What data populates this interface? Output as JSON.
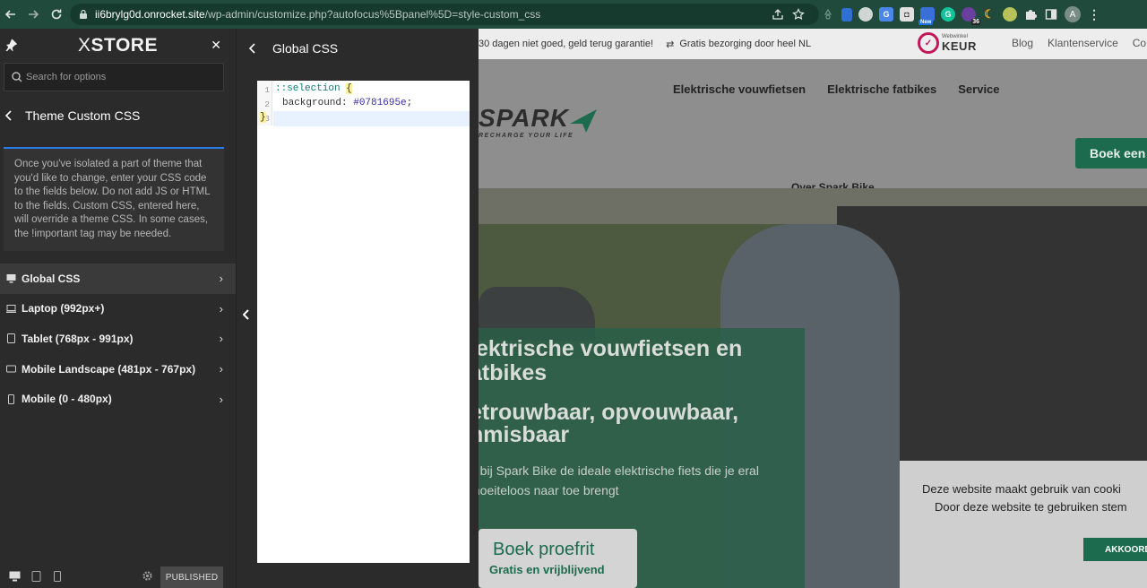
{
  "browser": {
    "url_host": "ii6brylg0d.onrocket.site",
    "url_path": "/wp-admin/customize.php?autofocus%5Bpanel%5D=style-custom_css",
    "extension_badge": "36",
    "new_badge": "New",
    "profile_initial": "A"
  },
  "sidebar": {
    "logo_x": "X",
    "logo_text": "STORE",
    "search_placeholder": "Search for options",
    "section_title": "Theme Custom CSS",
    "notice": "Once you've isolated a part of theme that you'd like to change, enter your CSS code to the fields below. Do not add JS or HTML to the fields. Custom CSS, entered here, will override a theme CSS. In some cases, the !important tag may be needed.",
    "items": [
      {
        "label": "Global CSS",
        "icon": "desktop-icon",
        "active": true
      },
      {
        "label": "Laptop (992px+)",
        "icon": "laptop-icon",
        "active": false
      },
      {
        "label": "Tablet (768px - 991px)",
        "icon": "tablet-icon",
        "active": false
      },
      {
        "label": "Mobile Landscape (481px - 767px)",
        "icon": "mobile-landscape-icon",
        "active": false
      },
      {
        "label": "Mobile (0 - 480px)",
        "icon": "mobile-icon",
        "active": false
      }
    ],
    "publish_label": "PUBLISHED"
  },
  "panel": {
    "title": "Global CSS",
    "code_lines": [
      {
        "num": "1",
        "selector": "::selection",
        "brace": "{"
      },
      {
        "num": "2",
        "property": "background:",
        "value": "#0781695e",
        "semi": ";"
      },
      {
        "num": "3",
        "brace": "}"
      }
    ]
  },
  "site": {
    "promo1": "30 dagen niet goed, geld terug garantie!",
    "promo2": "Gratis bezorging door heel NL",
    "keur_small": "Webwinkel",
    "keur_big": "KEUR",
    "top_links": [
      "Blog",
      "Klantenservice",
      "Co"
    ],
    "nav": [
      "Elektrische vouwfietsen",
      "Elektrische fatbikes",
      "Service"
    ],
    "logo_text": "SPARK",
    "logo_tagline": "RECHARGE YOUR LIFE",
    "boek_een": "Boek een",
    "over": "Over Spark Bike",
    "hero_h1": "lektrische vouwfietsen en atbikes",
    "hero_h2": "etrouwbaar, opvouwbaar, nmisbaar",
    "hero_p": "d bij Spark Bike de ideale elektrische fiets die je eral moeiteloos naar toe brengt",
    "proefrit_title": "Boek proefrit",
    "proefrit_sub": "Gratis en vrijblijvend",
    "cookie_line1": "Deze website maakt gebruik van cooki",
    "cookie_line2": "Door deze website te gebruiken stem",
    "cookie_accept": "AKKOORD"
  },
  "colors": {
    "browser_chrome": "#1f4a3c",
    "sidebar_bg": "#2b2b2b",
    "accent_blue": "#2c7be5",
    "site_green": "#1c6b4f"
  }
}
